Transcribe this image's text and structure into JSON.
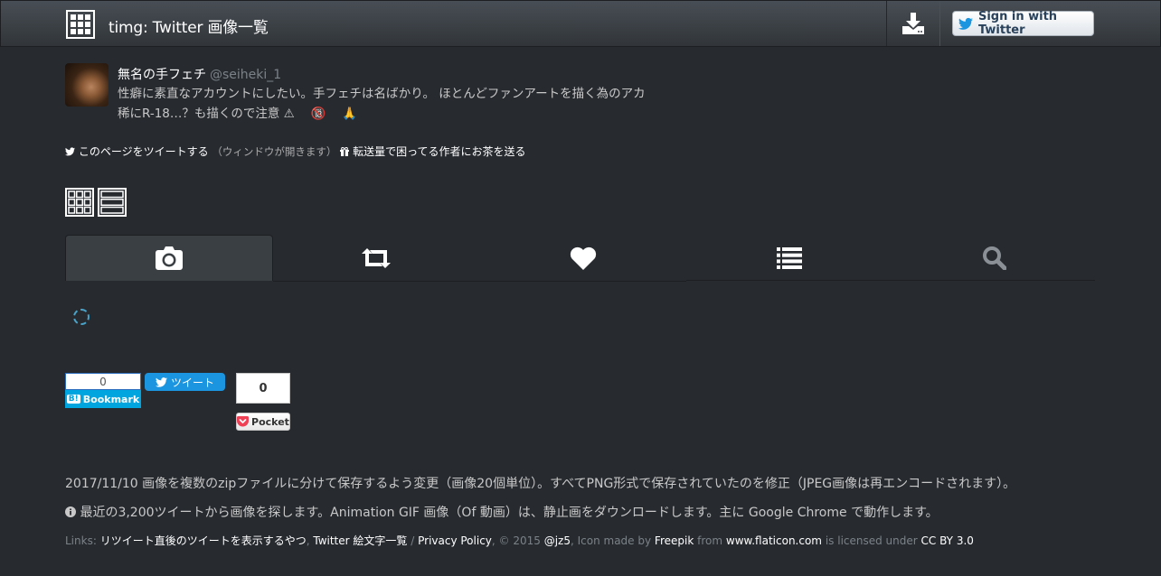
{
  "navbar": {
    "title": "timg: Twitter 画像一覧",
    "download_icon": "download-icon",
    "signin_label": "Sign in with Twitter"
  },
  "profile": {
    "name": "無名の手フェチ",
    "handle": "@seiheki_1",
    "bio": "性癖に素直なアカウントにしたい。手フェチは名ばかり。 ほとんどファンアートを描く為のアカ 稀にR-18…？も描くので注意 ⚠︎ 　🔞 　🙏"
  },
  "share": {
    "tweet_page": "このページをツイートする",
    "window_note": "（ウィンドウが開きます）",
    "gift": "転送量で困ってる作者にお茶を送る"
  },
  "tabs": [
    {
      "icon": "camera-icon",
      "active": true
    },
    {
      "icon": "retweet-icon",
      "active": false
    },
    {
      "icon": "heart-icon",
      "active": false
    },
    {
      "icon": "list-icon",
      "active": false
    },
    {
      "icon": "search-icon",
      "active": false
    }
  ],
  "social": {
    "hatena_count": "0",
    "hatena_label": "Bookmark",
    "tweet_label": "ツイート",
    "pocket_count": "0",
    "pocket_label": "Pocket"
  },
  "notices": {
    "update": "2017/11/10 画像を複数のzipファイルに分けて保存するよう変更（画像20個単位）。すべてPNG形式で保存されていたのを修正（JPEG画像は再エンコードされます）。",
    "info": "最近の3,200ツイートから画像を探します。Animation GIF 画像（Of 動画）は、静止画をダウンロードします。主に Google Chrome で動作します。"
  },
  "footer": {
    "links_label": "Links:",
    "link1": "リツイート直後のツイートを表示するやつ",
    "link2": "Twitter 絵文字一覧",
    "sep": "/",
    "link3": "Privacy Policy",
    "copyright": ", © 2015",
    "author": "@jz5",
    "icon_made_by": ", Icon made by",
    "freepik": "Freepik",
    "from": "from",
    "flaticon": "www.flaticon.com",
    "licensed": "is licensed under",
    "license": "CC BY 3.0"
  },
  "colors": {
    "background": "#272b30",
    "navbar": "#3a3f44",
    "twitter_blue": "#1b95e0",
    "hatena_blue": "#00a4de",
    "pocket_red": "#ef4056"
  }
}
